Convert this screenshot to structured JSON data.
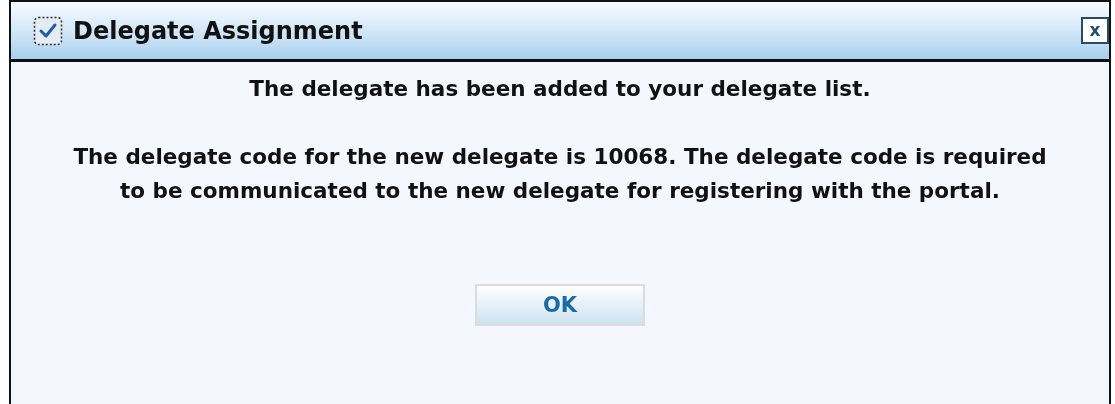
{
  "window": {
    "title": "Delegate Assignment",
    "close": "x"
  },
  "messages": [
    "The delegate has been added to your delegate list.",
    "The delegate code for the new delegate is 10068. The delegate code is required to be communicated to the new delegate for registering with the portal."
  ],
  "buttons": [
    "OK"
  ]
}
